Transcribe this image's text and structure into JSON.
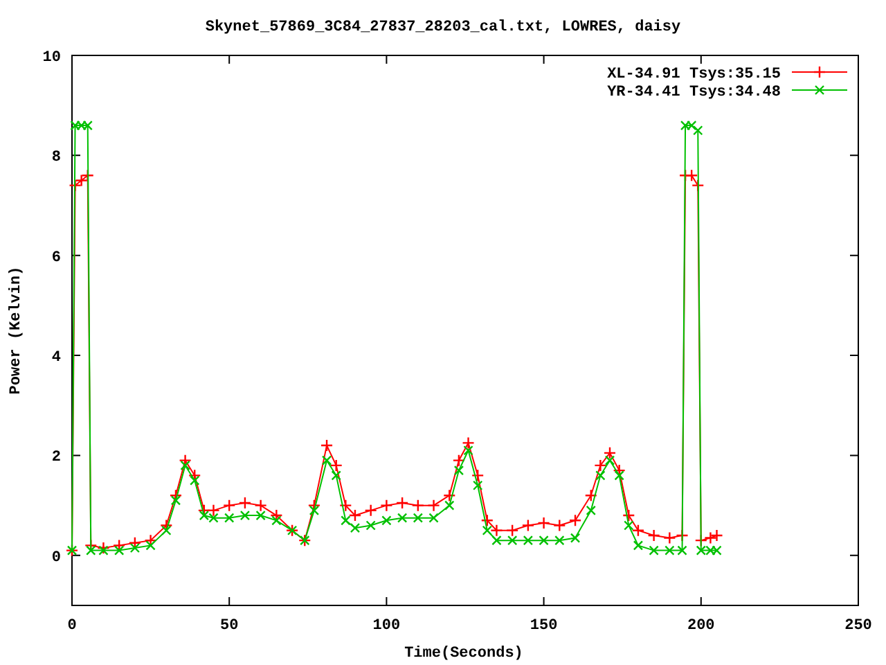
{
  "chart_data": {
    "type": "line",
    "title": "Skynet_57869_3C84_27837_28203_cal.txt, LOWRES, daisy",
    "xlabel": "Time(Seconds)",
    "ylabel": "Power (Kelvin)",
    "x": [
      0,
      1,
      3,
      5,
      6,
      10,
      15,
      20,
      25,
      30,
      33,
      36,
      39,
      42,
      45,
      50,
      55,
      60,
      65,
      70,
      74,
      77,
      81,
      84,
      87,
      90,
      95,
      100,
      105,
      110,
      115,
      120,
      123,
      126,
      129,
      132,
      135,
      140,
      145,
      150,
      155,
      160,
      165,
      168,
      171,
      174,
      177,
      180,
      185,
      190,
      194,
      195,
      197,
      199,
      200,
      203,
      205
    ],
    "series": [
      {
        "name": "XL-34.91 Tsys:35.15",
        "color": "#ff0000",
        "marker": "plus",
        "values": [
          0.1,
          7.4,
          7.5,
          7.6,
          0.2,
          0.15,
          0.2,
          0.25,
          0.3,
          0.6,
          1.2,
          1.9,
          1.6,
          0.9,
          0.9,
          1.0,
          1.05,
          1.0,
          0.8,
          0.5,
          0.3,
          1.0,
          2.2,
          1.8,
          1.0,
          0.8,
          0.9,
          1.0,
          1.05,
          1.0,
          1.0,
          1.2,
          1.9,
          2.25,
          1.6,
          0.7,
          0.5,
          0.5,
          0.6,
          0.65,
          0.6,
          0.7,
          1.2,
          1.8,
          2.05,
          1.7,
          0.8,
          0.5,
          0.4,
          0.35,
          0.4,
          7.6,
          7.6,
          7.4,
          0.3,
          0.35,
          0.4
        ]
      },
      {
        "name": "YR-34.41 Tsys:34.48",
        "color": "#00c000",
        "marker": "x",
        "values": [
          0.1,
          8.6,
          8.6,
          8.6,
          0.1,
          0.1,
          0.1,
          0.15,
          0.2,
          0.5,
          1.1,
          1.8,
          1.5,
          0.8,
          0.75,
          0.75,
          0.8,
          0.8,
          0.7,
          0.5,
          0.3,
          0.9,
          1.9,
          1.6,
          0.7,
          0.55,
          0.6,
          0.7,
          0.75,
          0.75,
          0.75,
          1.0,
          1.7,
          2.1,
          1.4,
          0.5,
          0.3,
          0.3,
          0.3,
          0.3,
          0.3,
          0.35,
          0.9,
          1.6,
          1.9,
          1.6,
          0.6,
          0.2,
          0.1,
          0.1,
          0.1,
          8.6,
          8.6,
          8.5,
          0.1,
          0.1,
          0.1
        ]
      }
    ],
    "legend": "upper right",
    "xlim": [
      0,
      250
    ],
    "ylim": [
      -1,
      10
    ],
    "xticks": [
      0,
      50,
      100,
      150,
      200,
      250
    ],
    "yticks": [
      0,
      2,
      4,
      6,
      8,
      10
    ]
  }
}
